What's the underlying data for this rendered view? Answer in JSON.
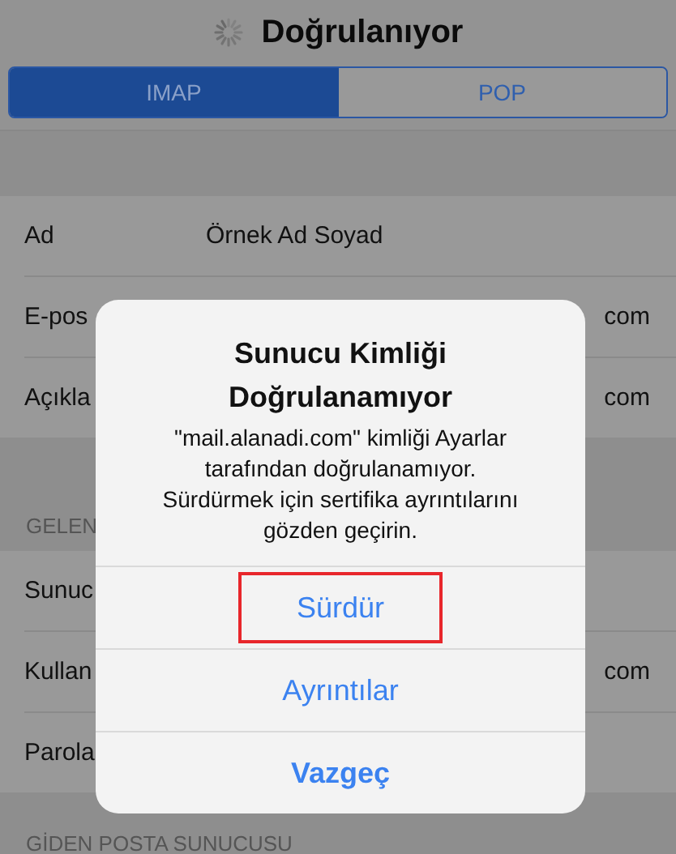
{
  "nav": {
    "title": "Doğrulanıyor",
    "loading": true
  },
  "tabs": [
    {
      "label": "IMAP",
      "selected": true
    },
    {
      "label": "POP",
      "selected": false
    }
  ],
  "account_rows": [
    {
      "label": "Ad",
      "value": "Örnek Ad Soyad"
    },
    {
      "label": "E-pos",
      "value": "com"
    },
    {
      "label": "Açıkla",
      "value": "com"
    }
  ],
  "incoming_header": "GELEN",
  "incoming_rows": [
    {
      "label": "Sunuc",
      "value": ""
    },
    {
      "label": "Kullan",
      "value": "com"
    },
    {
      "label": "Parola",
      "value": ""
    }
  ],
  "outgoing_header": "GİDEN POSTA SUNUCUSU",
  "alert": {
    "title": "Sunucu Kimliği Doğrulanamıyor",
    "message": "\"mail.alanadi.com\"  kimliği Ayarlar tarafından doğrulanamıyor. Sürdürmek için sertifika ayrıntılarını gözden geçirin.",
    "actions": [
      {
        "label": "Sürdür",
        "kind": "default",
        "highlighted": true
      },
      {
        "label": "Ayrıntılar",
        "kind": "default",
        "highlighted": false
      },
      {
        "label": "Vazgeç",
        "kind": "cancel",
        "highlighted": false
      }
    ]
  }
}
